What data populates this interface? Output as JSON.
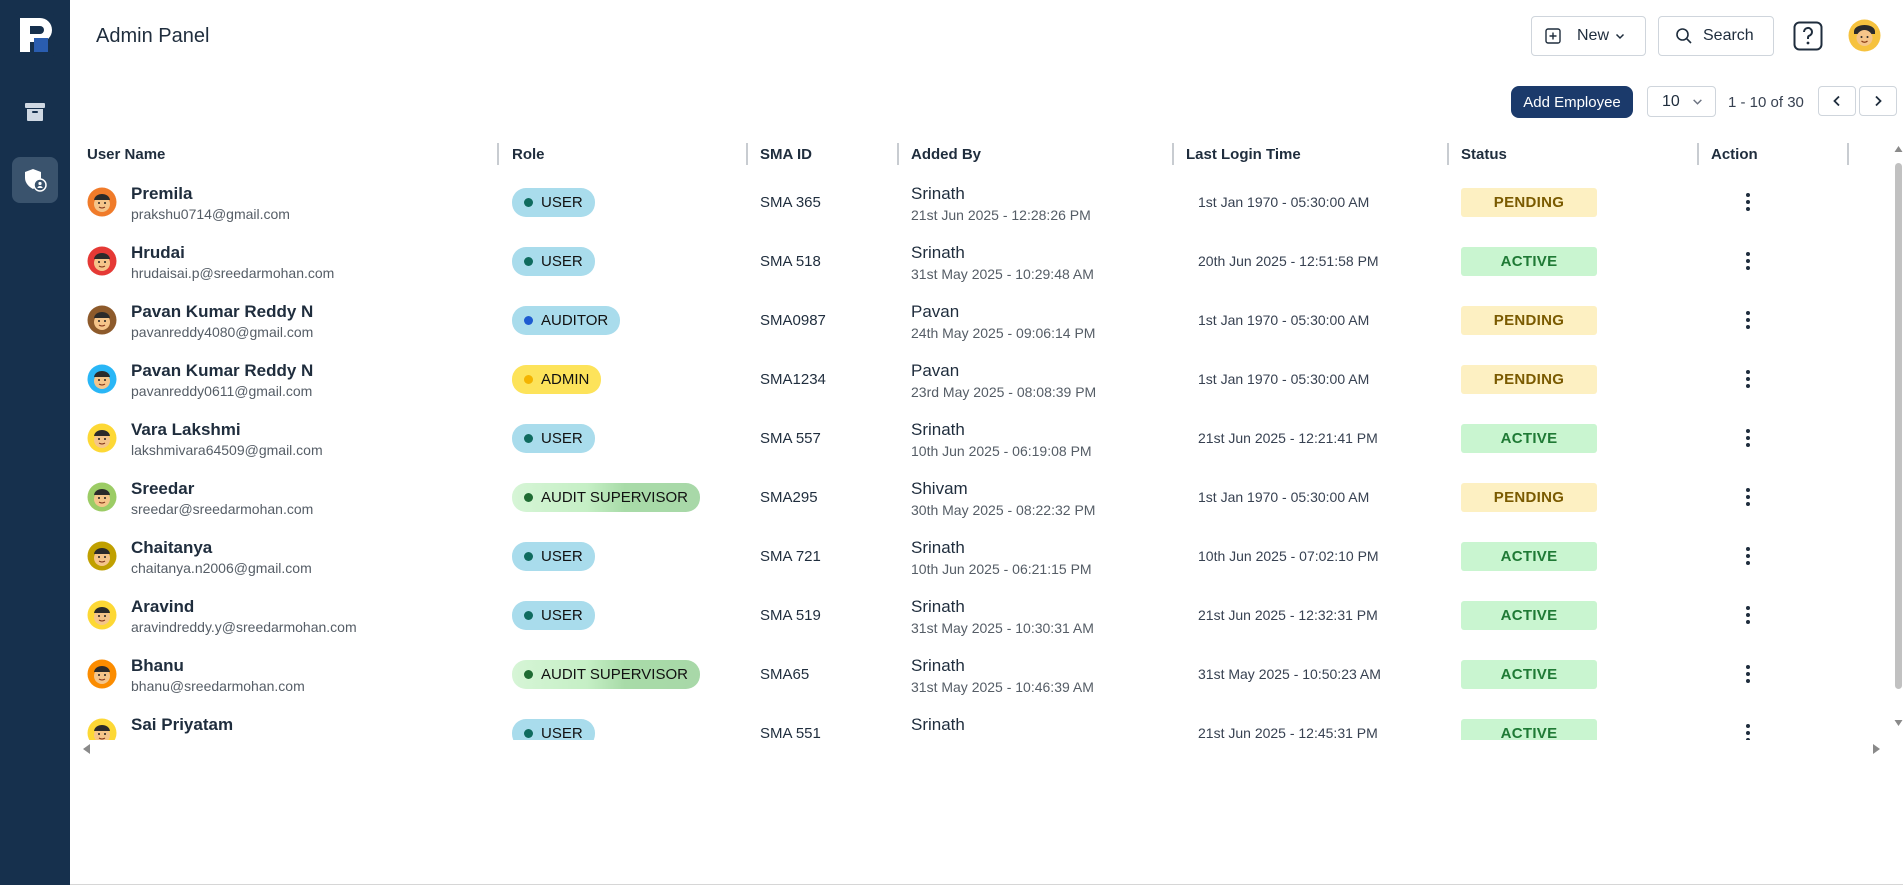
{
  "app": {
    "title": "Admin Panel",
    "new_label": "New",
    "search_label": "Search",
    "sidebar": [
      {
        "name": "archive",
        "icon": "archive-icon"
      },
      {
        "name": "admin",
        "icon": "shield-user-icon",
        "active": true
      }
    ]
  },
  "toolbar": {
    "add_employee_label": "Add Employee",
    "page_size": "10",
    "range_text": "1 - 10 of 30"
  },
  "table": {
    "headers": [
      "User Name",
      "Role",
      "SMA ID",
      "Added By",
      "Last Login Time",
      "Status",
      "Action"
    ],
    "rows": [
      {
        "name": "Premila",
        "email": "prakshu0714@gmail.com",
        "role": "USER",
        "role_type": "user",
        "sma_id": "SMA 365",
        "added_by": "Srinath",
        "added_date": "21st Jun 2025 - 12:28:26 PM",
        "last_login": "1st Jan 1970 - 05:30:00 AM",
        "status": "PENDING",
        "avatar_color": "#f07b2a"
      },
      {
        "name": "Hrudai",
        "email": "hrudaisai.p@sreedarmohan.com",
        "role": "USER",
        "role_type": "user",
        "sma_id": "SMA 518",
        "added_by": "Srinath",
        "added_date": "31st May 2025 - 10:29:48 AM",
        "last_login": "20th Jun 2025 - 12:51:58 PM",
        "status": "ACTIVE",
        "avatar_color": "#e53935"
      },
      {
        "name": "Pavan Kumar Reddy N",
        "email": "pavanreddy4080@gmail.com",
        "role": "AUDITOR",
        "role_type": "auditor",
        "sma_id": "SMA0987",
        "added_by": "Pavan",
        "added_date": "24th May 2025 - 09:06:14 PM",
        "last_login": "1st Jan 1970 - 05:30:00 AM",
        "status": "PENDING",
        "avatar_color": "#8d5a2b"
      },
      {
        "name": "Pavan Kumar Reddy N",
        "email": "pavanreddy0611@gmail.com",
        "role": "ADMIN",
        "role_type": "admin",
        "sma_id": "SMA1234",
        "added_by": "Pavan",
        "added_date": "23rd May 2025 - 08:08:39 PM",
        "last_login": "1st Jan 1970 - 05:30:00 AM",
        "status": "PENDING",
        "avatar_color": "#29b6f6"
      },
      {
        "name": "Vara Lakshmi",
        "email": "lakshmivara64509@gmail.com",
        "role": "USER",
        "role_type": "user",
        "sma_id": "SMA 557",
        "added_by": "Srinath",
        "added_date": "10th Jun 2025 - 06:19:08 PM",
        "last_login": "21st Jun 2025 - 12:21:41 PM",
        "status": "ACTIVE",
        "avatar_color": "#fdd835"
      },
      {
        "name": "Sreedar",
        "email": "sreedar@sreedarmohan.com",
        "role": "AUDIT SUPERVISOR",
        "role_type": "sup",
        "sma_id": "SMA295",
        "added_by": "Shivam",
        "added_date": "30th May 2025 - 08:22:32 PM",
        "last_login": "1st Jan 1970 - 05:30:00 AM",
        "status": "PENDING",
        "avatar_color": "#9ccc65"
      },
      {
        "name": "Chaitanya",
        "email": "chaitanya.n2006@gmail.com",
        "role": "USER",
        "role_type": "user",
        "sma_id": "SMA 721",
        "added_by": "Srinath",
        "added_date": "10th Jun 2025 - 06:21:15 PM",
        "last_login": "10th Jun 2025 - 07:02:10 PM",
        "status": "ACTIVE",
        "avatar_color": "#c0a000"
      },
      {
        "name": "Aravind",
        "email": "aravindreddy.y@sreedarmohan.com",
        "role": "USER",
        "role_type": "user",
        "sma_id": "SMA 519",
        "added_by": "Srinath",
        "added_date": "31st May 2025 - 10:30:31 AM",
        "last_login": "21st Jun 2025 - 12:32:31 PM",
        "status": "ACTIVE",
        "avatar_color": "#fdd835"
      },
      {
        "name": "Bhanu",
        "email": "bhanu@sreedarmohan.com",
        "role": "AUDIT SUPERVISOR",
        "role_type": "sup",
        "sma_id": "SMA65",
        "added_by": "Srinath",
        "added_date": "31st May 2025 - 10:46:39 AM",
        "last_login": "31st May 2025 - 10:50:23 AM",
        "status": "ACTIVE",
        "avatar_color": "#fb8c00"
      },
      {
        "name": "Sai Priyatam",
        "email": "",
        "role": "USER",
        "role_type": "user",
        "sma_id": "SMA 551",
        "added_by": "Srinath",
        "added_date": "",
        "last_login": "21st Jun 2025 - 12:45:31 PM",
        "status": "ACTIVE",
        "avatar_color": "#fdd835"
      }
    ]
  },
  "colors": {
    "sidebar_bg": "#16304d",
    "primary_button": "#1b3a6b",
    "pending_bg": "#fdf0c2",
    "active_bg": "#c9f5d0"
  }
}
